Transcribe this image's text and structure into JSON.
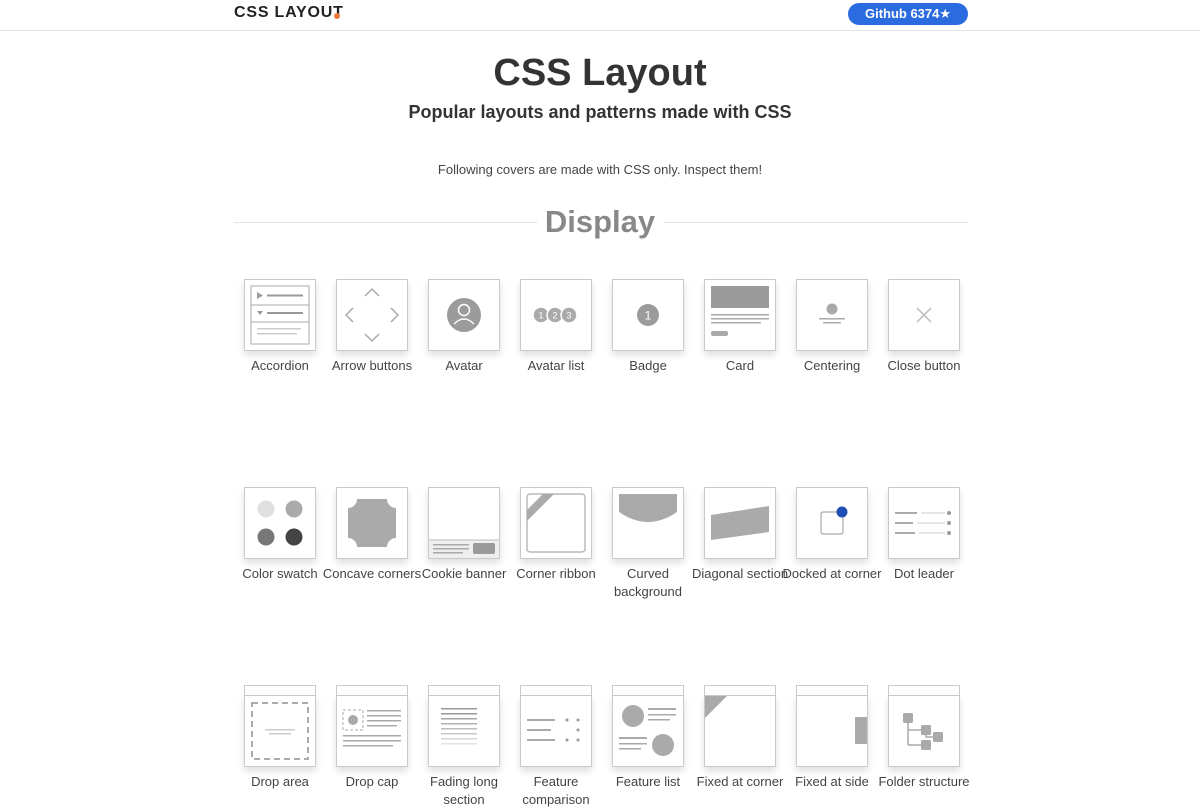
{
  "header": {
    "logo": "CSS LAYOUT",
    "github": "Github 6374★"
  },
  "hero": {
    "title": "CSS Layout",
    "subtitle": "Popular layouts and patterns made with CSS"
  },
  "intro": "Following covers are made with CSS only. Inspect them!",
  "section": {
    "title": "Display"
  },
  "colors": {
    "accent": "#2a6bdf",
    "logo_dot": "#f07a3a",
    "docked_dot": "#1f4fb3"
  },
  "patterns": [
    {
      "label": "Accordion",
      "icon": "accordion-icon"
    },
    {
      "label": "Arrow buttons",
      "icon": "arrow-buttons-icon"
    },
    {
      "label": "Avatar",
      "icon": "avatar-icon"
    },
    {
      "label": "Avatar list",
      "icon": "avatar-list-icon",
      "avatars": [
        "1",
        "2",
        "3"
      ]
    },
    {
      "label": "Badge",
      "icon": "badge-icon",
      "badge": "1"
    },
    {
      "label": "Card",
      "icon": "card-icon"
    },
    {
      "label": "Centering",
      "icon": "centering-icon"
    },
    {
      "label": "Close button",
      "icon": "close-icon"
    },
    {
      "label": "Color swatch",
      "icon": "color-swatch-icon"
    },
    {
      "label": "Concave corners",
      "icon": "concave-corners-icon"
    },
    {
      "label": "Cookie banner",
      "icon": "cookie-banner-icon"
    },
    {
      "label": "Corner ribbon",
      "icon": "corner-ribbon-icon"
    },
    {
      "label": "Curved background",
      "icon": "curved-background-icon"
    },
    {
      "label": "Diagonal section",
      "icon": "diagonal-section-icon"
    },
    {
      "label": "Docked at corner",
      "icon": "docked-at-corner-icon"
    },
    {
      "label": "Dot leader",
      "icon": "dot-leader-icon"
    },
    {
      "label": "Drop area",
      "icon": "drop-area-icon"
    },
    {
      "label": "Drop cap",
      "icon": "drop-cap-icon"
    },
    {
      "label": "Fading long section",
      "icon": "fading-long-section-icon"
    },
    {
      "label": "Feature comparison",
      "icon": "feature-comparison-icon"
    },
    {
      "label": "Feature list",
      "icon": "feature-list-icon"
    },
    {
      "label": "Fixed at corner",
      "icon": "fixed-at-corner-icon"
    },
    {
      "label": "Fixed at side",
      "icon": "fixed-at-side-icon"
    },
    {
      "label": "Folder structure",
      "icon": "folder-structure-icon"
    }
  ]
}
